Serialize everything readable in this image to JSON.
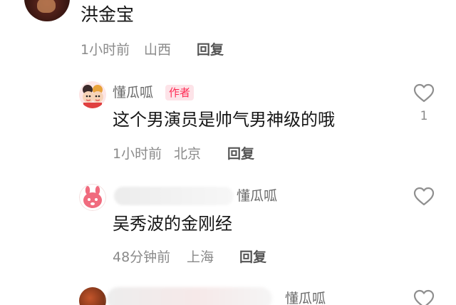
{
  "top_comment": {
    "text": "洪金宝",
    "time": "1小时前",
    "location": "山西",
    "reply_label": "回复"
  },
  "replies": [
    {
      "username": "懂瓜呱",
      "badge": "作者",
      "text": "这个男演员是帅气男神级的哦",
      "time": "1小时前",
      "location": "北京",
      "reply_label": "回复",
      "like_count": "1"
    },
    {
      "reply_to": "懂瓜呱",
      "text": "吴秀波的金刚经",
      "time": "48分钟前",
      "location": "上海",
      "reply_label": "回复"
    },
    {
      "reply_to": "懂瓜呱"
    }
  ],
  "colors": {
    "accent": "#fe2c55",
    "text": "#161616",
    "meta": "#8a8a8a"
  },
  "icons": {
    "like": "heart-outline-icon"
  }
}
